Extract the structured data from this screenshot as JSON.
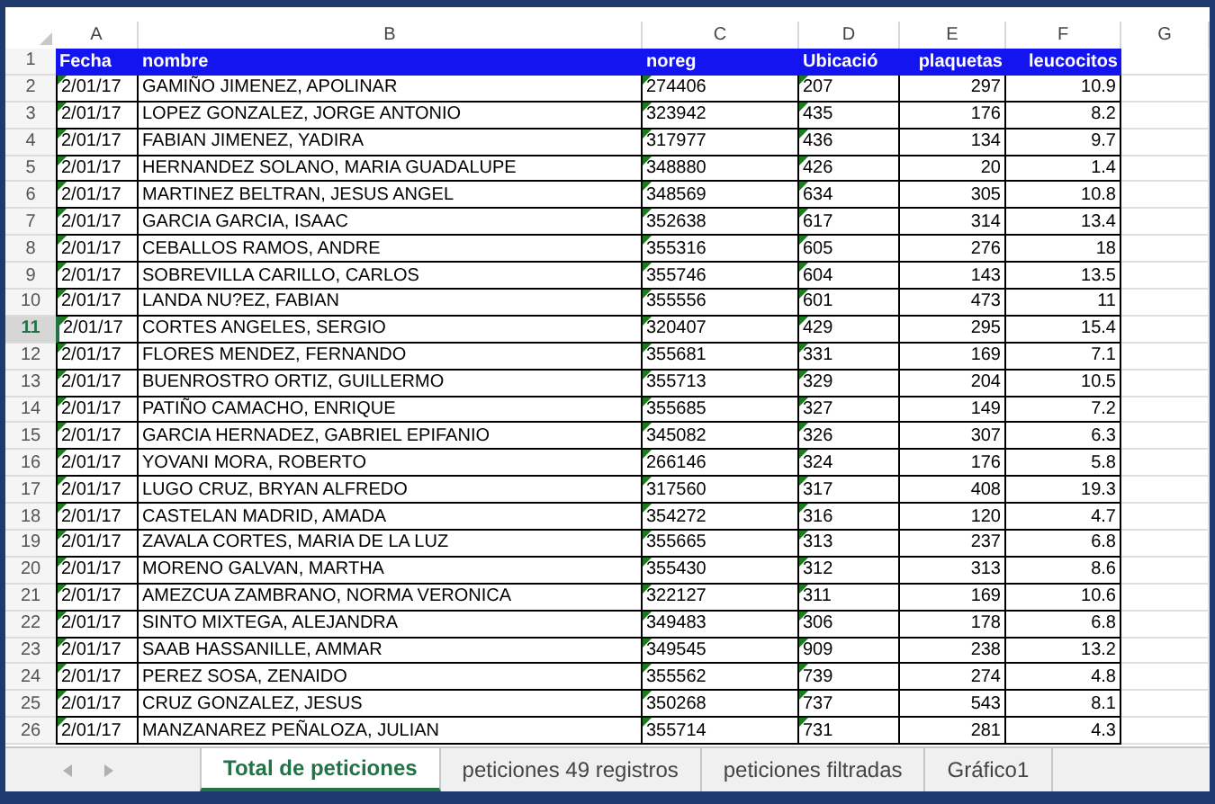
{
  "columns": [
    {
      "letter": "A"
    },
    {
      "letter": "B"
    },
    {
      "letter": "C"
    },
    {
      "letter": "D"
    },
    {
      "letter": "E"
    },
    {
      "letter": "F"
    },
    {
      "letter": "G"
    }
  ],
  "header": {
    "number": "1",
    "cells": [
      "Fecha",
      "nombre",
      "noreg",
      "Ubicació",
      "plaquetas",
      "leucocitos"
    ]
  },
  "rows": [
    {
      "number": "2",
      "selected": false,
      "cells": [
        "2/01/17",
        "GAMIÑO JIMENEZ, APOLINAR",
        "274406",
        "207",
        "297",
        "10.9"
      ]
    },
    {
      "number": "3",
      "selected": false,
      "cells": [
        "2/01/17",
        "LOPEZ GONZALEZ, JORGE ANTONIO",
        "323942",
        "435",
        "176",
        "8.2"
      ]
    },
    {
      "number": "4",
      "selected": false,
      "cells": [
        "2/01/17",
        "FABIAN JIMENEZ, YADIRA",
        "317977",
        "436",
        "134",
        "9.7"
      ]
    },
    {
      "number": "5",
      "selected": false,
      "cells": [
        "2/01/17",
        "HERNANDEZ SOLANO, MARIA GUADALUPE",
        "348880",
        "426",
        "20",
        "1.4"
      ]
    },
    {
      "number": "6",
      "selected": false,
      "cells": [
        "2/01/17",
        "MARTINEZ BELTRAN, JESUS ANGEL",
        "348569",
        "634",
        "305",
        "10.8"
      ]
    },
    {
      "number": "7",
      "selected": false,
      "cells": [
        "2/01/17",
        "GARCIA GARCIA, ISAAC",
        "352638",
        "617",
        "314",
        "13.4"
      ]
    },
    {
      "number": "8",
      "selected": false,
      "cells": [
        "2/01/17",
        "CEBALLOS RAMOS, ANDRE",
        "355316",
        "605",
        "276",
        "18"
      ]
    },
    {
      "number": "9",
      "selected": false,
      "cells": [
        "2/01/17",
        "SOBREVILLA CARILLO, CARLOS",
        "355746",
        "604",
        "143",
        "13.5"
      ]
    },
    {
      "number": "10",
      "selected": false,
      "cells": [
        "2/01/17",
        "LANDA NU?EZ, FABIAN",
        "355556",
        "601",
        "473",
        "11"
      ]
    },
    {
      "number": "11",
      "selected": true,
      "cells": [
        "2/01/17",
        "CORTES ANGELES, SERGIO",
        "320407",
        "429",
        "295",
        "15.4"
      ]
    },
    {
      "number": "12",
      "selected": false,
      "cells": [
        "2/01/17",
        "FLORES MENDEZ, FERNANDO",
        "355681",
        "331",
        "169",
        "7.1"
      ]
    },
    {
      "number": "13",
      "selected": false,
      "cells": [
        "2/01/17",
        "BUENROSTRO ORTIZ, GUILLERMO",
        "355713",
        "329",
        "204",
        "10.5"
      ]
    },
    {
      "number": "14",
      "selected": false,
      "cells": [
        "2/01/17",
        "PATIÑO CAMACHO, ENRIQUE",
        "355685",
        "327",
        "149",
        "7.2"
      ]
    },
    {
      "number": "15",
      "selected": false,
      "cells": [
        "2/01/17",
        "GARCIA HERNADEZ, GABRIEL EPIFANIO",
        "345082",
        "326",
        "307",
        "6.3"
      ]
    },
    {
      "number": "16",
      "selected": false,
      "cells": [
        "2/01/17",
        "YOVANI MORA, ROBERTO",
        "266146",
        "324",
        "176",
        "5.8"
      ]
    },
    {
      "number": "17",
      "selected": false,
      "cells": [
        "2/01/17",
        "LUGO CRUZ, BRYAN ALFREDO",
        "317560",
        "317",
        "408",
        "19.3"
      ]
    },
    {
      "number": "18",
      "selected": false,
      "cells": [
        "2/01/17",
        "CASTELAN MADRID, AMADA",
        "354272",
        "316",
        "120",
        "4.7"
      ]
    },
    {
      "number": "19",
      "selected": false,
      "cells": [
        "2/01/17",
        "ZAVALA  CORTES, MARIA DE LA LUZ",
        "355665",
        "313",
        "237",
        "6.8"
      ]
    },
    {
      "number": "20",
      "selected": false,
      "cells": [
        "2/01/17",
        "MORENO GALVAN, MARTHA",
        "355430",
        "312",
        "313",
        "8.6"
      ]
    },
    {
      "number": "21",
      "selected": false,
      "cells": [
        "2/01/17",
        "AMEZCUA ZAMBRANO, NORMA VERONICA",
        "322127",
        "311",
        "169",
        "10.6"
      ]
    },
    {
      "number": "22",
      "selected": false,
      "cells": [
        "2/01/17",
        "SINTO MIXTEGA, ALEJANDRA",
        "349483",
        "306",
        "178",
        "6.8"
      ]
    },
    {
      "number": "23",
      "selected": false,
      "cells": [
        "2/01/17",
        "SAAB HASSANILLE, AMMAR",
        "349545",
        "909",
        "238",
        "13.2"
      ]
    },
    {
      "number": "24",
      "selected": false,
      "cells": [
        "2/01/17",
        "PEREZ SOSA, ZENAIDO",
        "355562",
        "739",
        "274",
        "4.8"
      ]
    },
    {
      "number": "25",
      "selected": false,
      "cells": [
        "2/01/17",
        "CRUZ GONZALEZ, JESUS",
        "350268",
        "737",
        "543",
        "8.1"
      ]
    },
    {
      "number": "26",
      "selected": false,
      "cells": [
        "2/01/17",
        "MANZANAREZ PEÑALOZA, JULIAN",
        "355714",
        "731",
        "281",
        "4.3"
      ]
    }
  ],
  "sheet_tabs": [
    {
      "label": "Total de peticiones",
      "selected": true
    },
    {
      "label": "peticiones 49 registros",
      "selected": false
    },
    {
      "label": "peticiones filtradas",
      "selected": false
    },
    {
      "label": "Gráfico1",
      "selected": false
    }
  ]
}
